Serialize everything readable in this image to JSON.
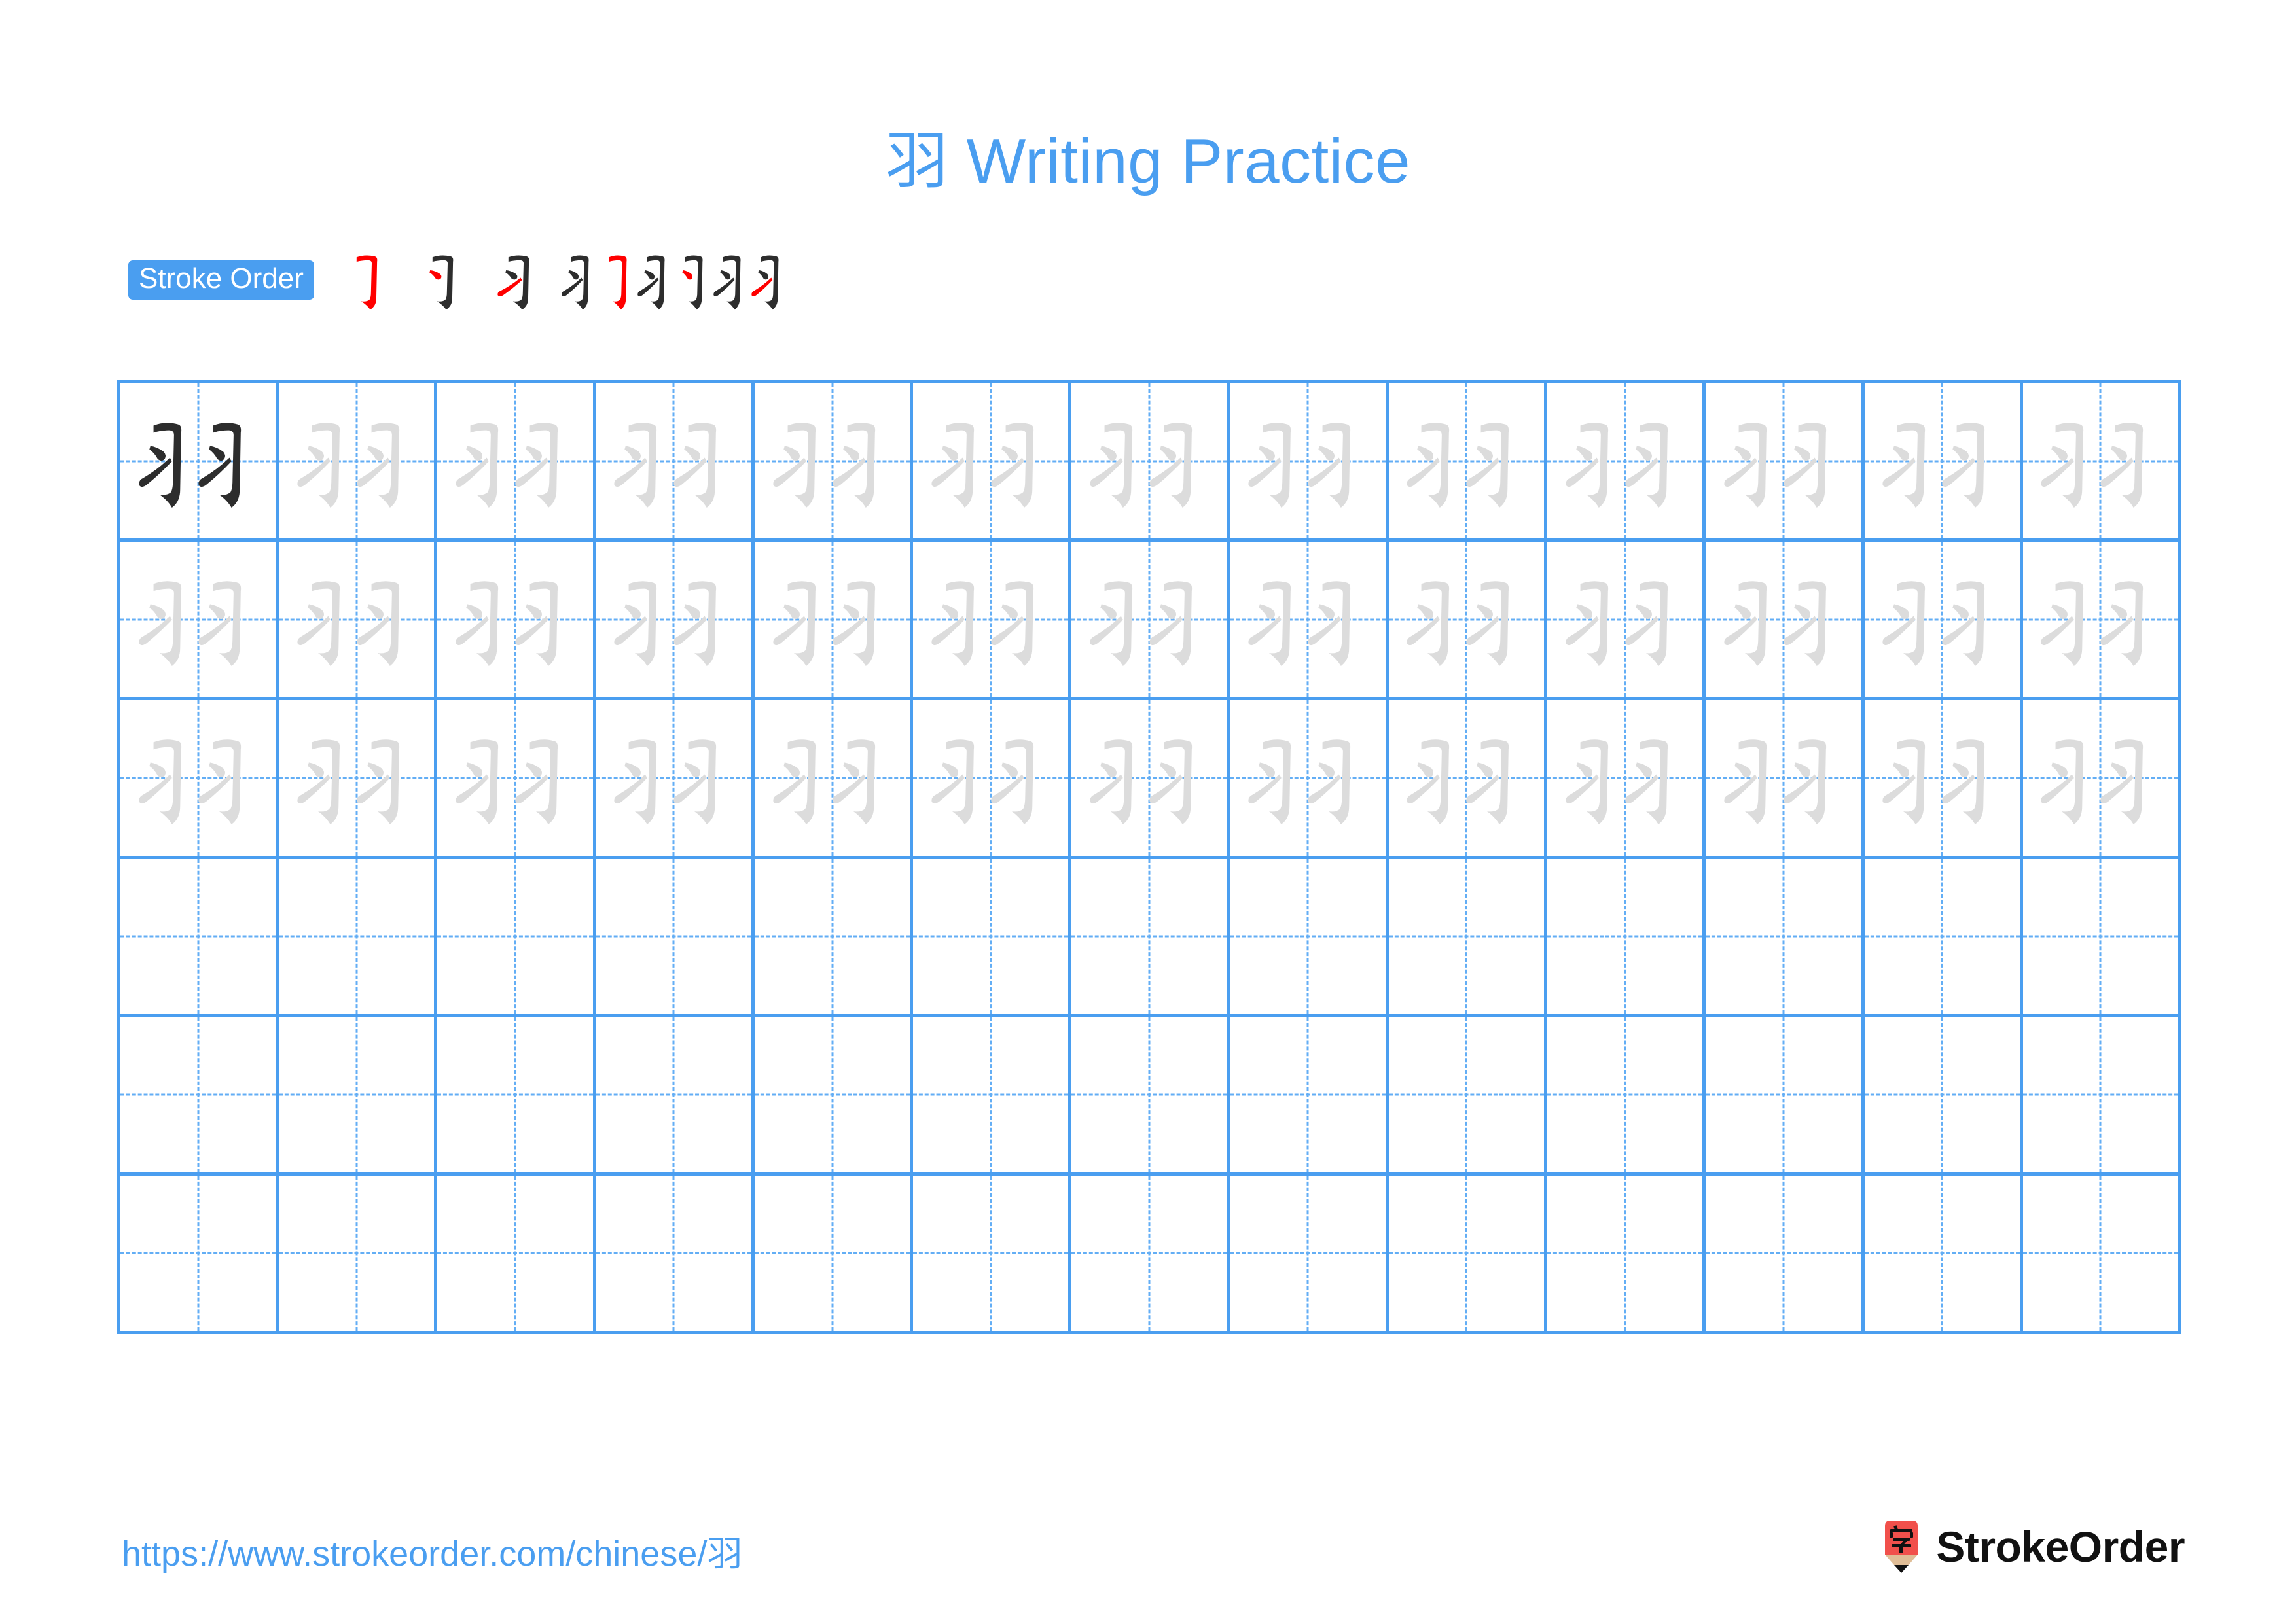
{
  "page": {
    "character": "羽",
    "title": "羽 Writing Practice",
    "title_prefix_char": "羽",
    "title_text": " Writing Practice",
    "background_color": "#ffffff"
  },
  "colors": {
    "accent_blue": "#4a9ef0",
    "grid_line_blue": "#4a9ef0",
    "guide_dash_blue": "#63aef5",
    "stroke_new": "#ff0000",
    "stroke_done": "#2d2d2d",
    "trace_gray": "#dcdcdc",
    "logo_red": "#f1504b",
    "logo_wood": "#e0bd96",
    "logo_tip": "#111111"
  },
  "stroke_order": {
    "badge_label": "Stroke Order",
    "step_count": 6,
    "steps": [
      {
        "index": 1,
        "strokes_shown": 1,
        "new_stroke": 1
      },
      {
        "index": 2,
        "strokes_shown": 2,
        "new_stroke": 2
      },
      {
        "index": 3,
        "strokes_shown": 3,
        "new_stroke": 3
      },
      {
        "index": 4,
        "strokes_shown": 4,
        "new_stroke": 4
      },
      {
        "index": 5,
        "strokes_shown": 5,
        "new_stroke": 5
      },
      {
        "index": 6,
        "strokes_shown": 6,
        "new_stroke": 6
      }
    ]
  },
  "practice_grid": {
    "columns": 13,
    "rows": 6,
    "rows_data": [
      {
        "row": 1,
        "cells": [
          "dark",
          "trace",
          "trace",
          "trace",
          "trace",
          "trace",
          "trace",
          "trace",
          "trace",
          "trace",
          "trace",
          "trace",
          "trace"
        ]
      },
      {
        "row": 2,
        "cells": [
          "trace",
          "trace",
          "trace",
          "trace",
          "trace",
          "trace",
          "trace",
          "trace",
          "trace",
          "trace",
          "trace",
          "trace",
          "trace"
        ]
      },
      {
        "row": 3,
        "cells": [
          "trace",
          "trace",
          "trace",
          "trace",
          "trace",
          "trace",
          "trace",
          "trace",
          "trace",
          "trace",
          "trace",
          "trace",
          "trace"
        ]
      },
      {
        "row": 4,
        "cells": [
          "empty",
          "empty",
          "empty",
          "empty",
          "empty",
          "empty",
          "empty",
          "empty",
          "empty",
          "empty",
          "empty",
          "empty",
          "empty"
        ]
      },
      {
        "row": 5,
        "cells": [
          "empty",
          "empty",
          "empty",
          "empty",
          "empty",
          "empty",
          "empty",
          "empty",
          "empty",
          "empty",
          "empty",
          "empty",
          "empty"
        ]
      },
      {
        "row": 6,
        "cells": [
          "empty",
          "empty",
          "empty",
          "empty",
          "empty",
          "empty",
          "empty",
          "empty",
          "empty",
          "empty",
          "empty",
          "empty",
          "empty"
        ]
      }
    ]
  },
  "footer": {
    "url": "https://www.strokeorder.com/chinese/羽",
    "brand_name": "StrokeOrder",
    "brand_mark_char": "字"
  }
}
